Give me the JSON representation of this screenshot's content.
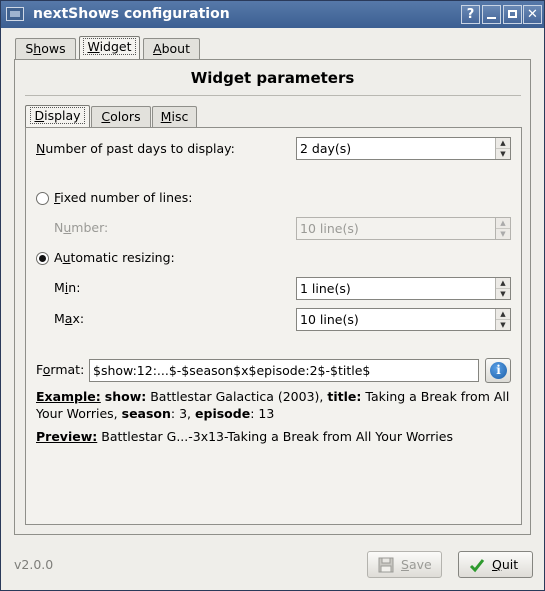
{
  "window": {
    "title": "nextShows configuration"
  },
  "titlebar_buttons": {
    "help": "?",
    "minimize": "▁",
    "maximize": "□",
    "close": "✕"
  },
  "main_tabs": [
    {
      "label": "Shows",
      "accel": "h"
    },
    {
      "label": "Widget",
      "accel": "W"
    },
    {
      "label": "About",
      "accel": "A"
    }
  ],
  "section_title": "Widget parameters",
  "sub_tabs": [
    {
      "label": "Display"
    },
    {
      "label": "Colors"
    },
    {
      "label": "Misc"
    }
  ],
  "display": {
    "past_days_label": "Number of past days to display:",
    "past_days_value": "2 day(s)",
    "fixed_lines_label": "Fixed number of lines:",
    "number_label": "Number:",
    "number_value": "10 line(s)",
    "auto_resize_label": "Automatic resizing:",
    "min_label": "Min:",
    "min_value": "1 line(s)",
    "max_label": "Max:",
    "max_value": "10 line(s)",
    "format_label": "Format:",
    "format_value": "$show:12:...$-$season$x$episode:2$-$title$",
    "example_heading": "Example:",
    "example_show_key": "show:",
    "example_show_val": "Battlestar Galactica (2003),",
    "example_title_key": "title:",
    "example_title_val": "Taking a Break from All Your Worries,",
    "example_season_key": "season",
    "example_season_val": ": 3,",
    "example_episode_key": "episode",
    "example_episode_val": ": 13",
    "preview_heading": "Preview:",
    "preview_value": "Battlestar G...-3x13-Taking a Break from All Your Worries"
  },
  "footer": {
    "version": "v2.0.0",
    "save_label": "Save",
    "quit_label": "Quit"
  },
  "colors": {
    "titlebar": "#4a6ea0",
    "info_icon": "#1b5ea8",
    "quit_check": "#2e9a2e"
  }
}
